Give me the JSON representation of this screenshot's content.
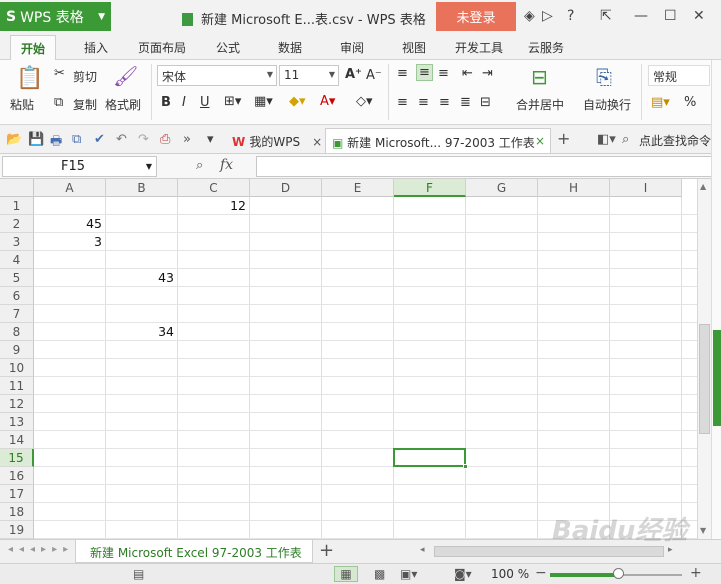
{
  "app": {
    "name": "WPS 表格",
    "logo": "S"
  },
  "window": {
    "title": "新建 Microsoft E...表.csv - WPS 表格",
    "login_label": "未登录"
  },
  "ribbon_tabs": [
    "开始",
    "插入",
    "页面布局",
    "公式",
    "数据",
    "审阅",
    "视图",
    "开发工具",
    "云服务"
  ],
  "ribbon": {
    "paste": "粘贴",
    "cut": "剪切",
    "copy": "复制",
    "format_painter": "格式刷",
    "font_name": "宋体",
    "font_size": "11",
    "merge_center": "合并居中",
    "wrap_text": "自动换行",
    "number_format": "常规",
    "percent": "%"
  },
  "quick_access": {
    "doc_tabs": [
      "我的WPS",
      "新建 Microsoft... 97-2003 工作表"
    ],
    "find_command": "点此查找命令"
  },
  "formula_bar": {
    "name_box": "F15",
    "fx": "fx",
    "value": ""
  },
  "columns": [
    "A",
    "B",
    "C",
    "D",
    "E",
    "F",
    "G",
    "H",
    "I"
  ],
  "rows": [
    "1",
    "2",
    "3",
    "4",
    "5",
    "6",
    "7",
    "8",
    "9",
    "10",
    "11",
    "12",
    "13",
    "14",
    "15",
    "16",
    "17",
    "18",
    "19"
  ],
  "cells": {
    "C1": "12",
    "A2": "45",
    "A3": "3",
    "B5": "43",
    "B8": "34"
  },
  "selected_cell": "F15",
  "sheet_tab": "新建 Microsoft Excel 97-2003 工作表",
  "status": {
    "zoom": "100 %"
  },
  "watermark": "Baidu经验",
  "colors": {
    "accent": "#3c9a36",
    "login": "#e8735a"
  }
}
